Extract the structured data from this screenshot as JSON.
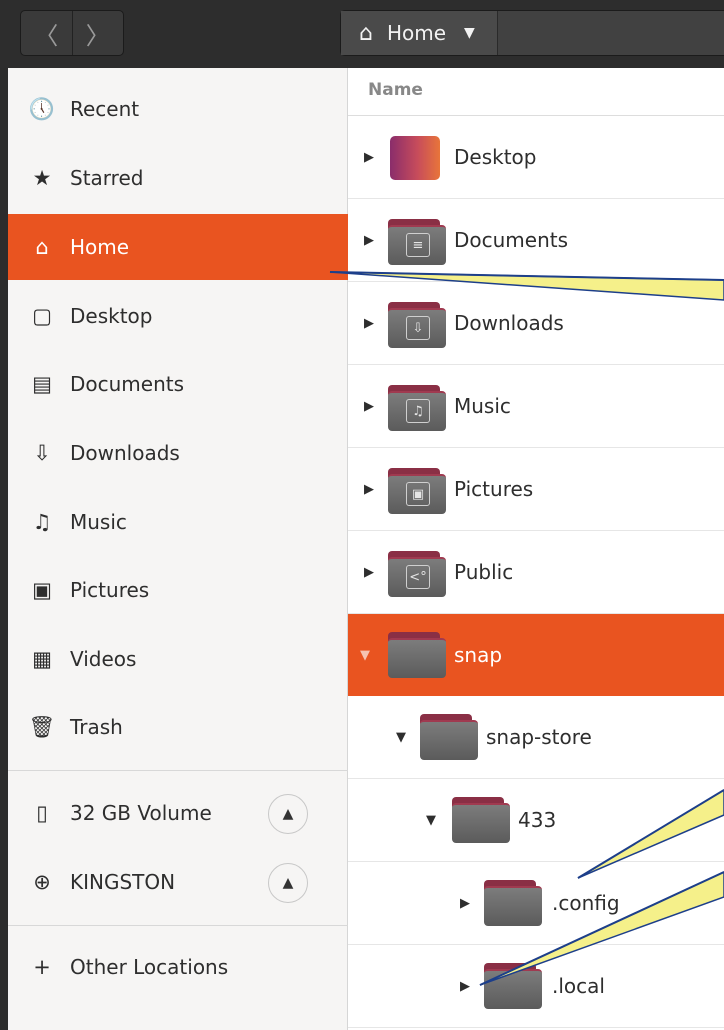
{
  "header": {
    "back_glyph": "〈",
    "forward_glyph": "〉",
    "path_label": "Home",
    "caret": "▼"
  },
  "sidebar": {
    "items": [
      {
        "label": "Recent",
        "icon": "clock-icon",
        "glyph": "🕔",
        "active": false
      },
      {
        "label": "Starred",
        "icon": "star-icon",
        "glyph": "★",
        "active": false
      },
      {
        "label": "Home",
        "icon": "home-icon",
        "glyph": "⌂",
        "active": true
      },
      {
        "label": "Desktop",
        "icon": "desktop-icon",
        "glyph": "▢",
        "active": false
      },
      {
        "label": "Documents",
        "icon": "document-icon",
        "glyph": "▤",
        "active": false
      },
      {
        "label": "Downloads",
        "icon": "download-icon",
        "glyph": "⇩",
        "active": false
      },
      {
        "label": "Music",
        "icon": "music-icon",
        "glyph": "♫",
        "active": false
      },
      {
        "label": "Pictures",
        "icon": "picture-icon",
        "glyph": "▣",
        "active": false
      },
      {
        "label": "Videos",
        "icon": "video-icon",
        "glyph": "▦",
        "active": false
      },
      {
        "label": "Trash",
        "icon": "trash-icon",
        "glyph": "🗑",
        "active": false
      }
    ],
    "devices": [
      {
        "label": "32 GB Volume",
        "icon": "drive-icon",
        "glyph": "▯",
        "eject": "▲"
      },
      {
        "label": "KINGSTON",
        "icon": "usb-icon",
        "glyph": "⊕",
        "eject": "▲"
      }
    ],
    "other": {
      "label": "Other Locations",
      "icon": "plus-icon",
      "glyph": "+"
    }
  },
  "list": {
    "column_header": "Name",
    "rows": [
      {
        "name": "Desktop",
        "icon": "desktop-folder-icon",
        "expander": "▶",
        "glyph": ""
      },
      {
        "name": "Documents",
        "icon": "documents-folder-icon",
        "expander": "▶",
        "glyph": "≡"
      },
      {
        "name": "Downloads",
        "icon": "downloads-folder-icon",
        "expander": "▶",
        "glyph": "⇩"
      },
      {
        "name": "Music",
        "icon": "music-folder-icon",
        "expander": "▶",
        "glyph": "♫"
      },
      {
        "name": "Pictures",
        "icon": "pictures-folder-icon",
        "expander": "▶",
        "glyph": "▣"
      },
      {
        "name": "Public",
        "icon": "public-folder-icon",
        "expander": "▶",
        "glyph": "<°"
      },
      {
        "name": "snap",
        "icon": "folder-icon",
        "expander": "▼",
        "glyph": "",
        "selected": true
      },
      {
        "name": "snap-store",
        "icon": "folder-icon",
        "expander": "▼",
        "glyph": ""
      },
      {
        "name": "433",
        "icon": "folder-icon",
        "expander": "▼",
        "glyph": ""
      },
      {
        "name": ".config",
        "icon": "folder-icon",
        "expander": "▶",
        "glyph": ""
      },
      {
        "name": ".local",
        "icon": "folder-icon",
        "expander": "▶",
        "glyph": ""
      }
    ]
  },
  "colors": {
    "accent": "#e95420",
    "sidebar_bg": "#f6f5f4",
    "header_bg": "#2d2d2d",
    "callout_fill": "#f5f08a",
    "callout_line": "#1d3f8a"
  }
}
